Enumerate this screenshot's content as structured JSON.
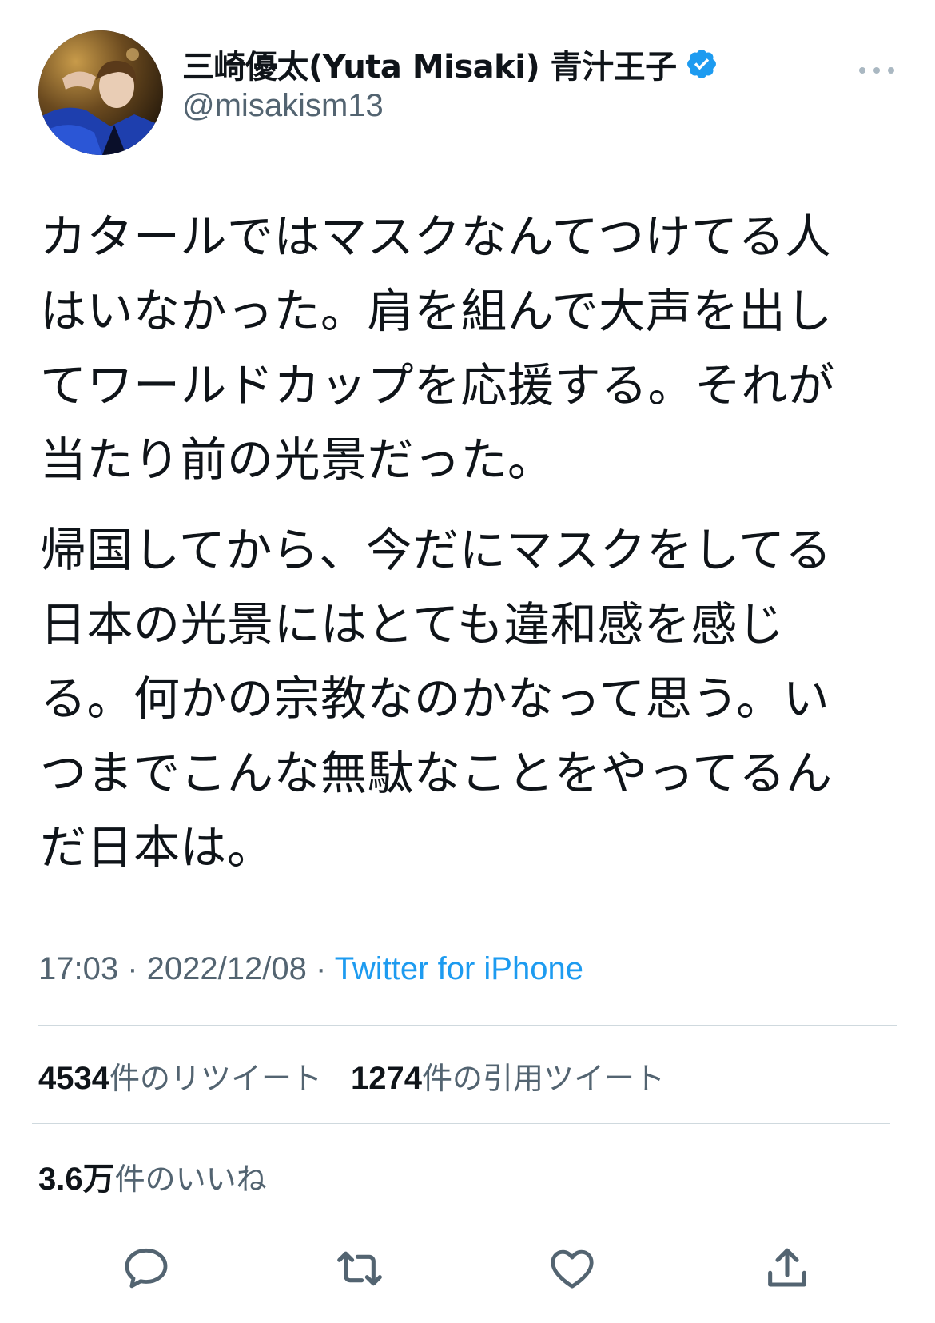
{
  "author": {
    "display_name": "三崎優太(Yuta Misaki) 青汁王子",
    "handle": "@misakism13",
    "verified": true
  },
  "tweet": {
    "paragraph1_lines": [
      "カタールではマスクなんてつけてる人",
      "はいなかった。肩を組んで大声を出し",
      "てワールドカップを応援する。それが",
      "当たり前の光景だった。"
    ],
    "paragraph2_lines": [
      "帰国してから、今だにマスクをしてる",
      "日本の光景にはとても違和感を感じ",
      "る。何かの宗教なのかなって思う。い",
      "つまでこんな無駄なことをやってるん",
      "だ日本は。"
    ]
  },
  "meta": {
    "time": "17:03",
    "separator": " · ",
    "date": "2022/12/08",
    "source": "Twitter for iPhone"
  },
  "stats": {
    "retweets_count": "4534",
    "retweets_label": "件のリツイート",
    "quotes_count": "1274",
    "quotes_label": "件の引用ツイート",
    "likes_count": "3.6万",
    "likes_label": "件のいいね"
  },
  "actions": [
    "reply-icon",
    "retweet-icon",
    "like-icon",
    "share-icon"
  ],
  "colors": {
    "text": "#0f1419",
    "secondary": "#536471",
    "link": "#1d9bf0",
    "divider": "#cfd9de"
  }
}
